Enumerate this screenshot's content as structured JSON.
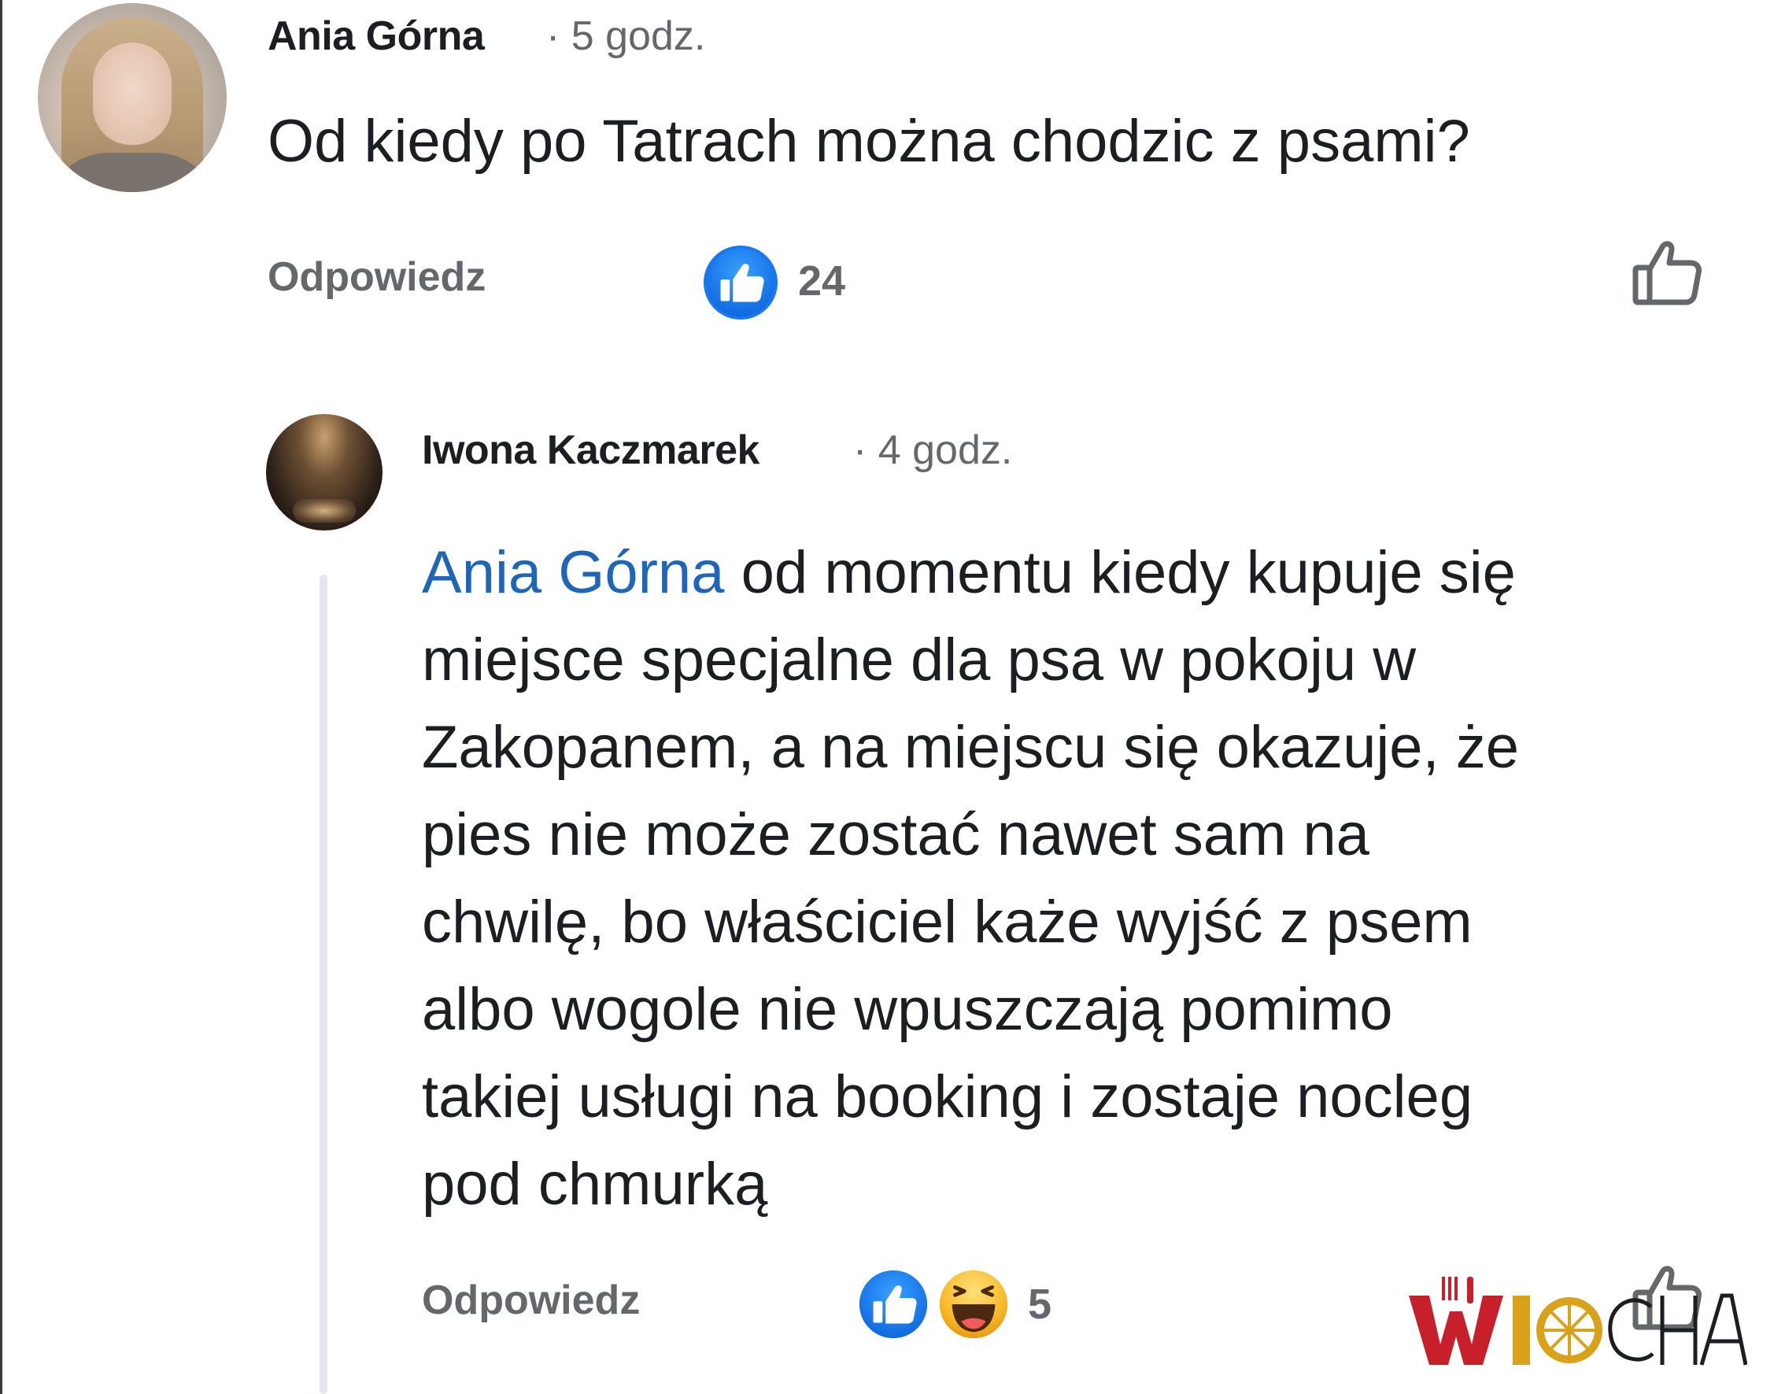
{
  "comments": [
    {
      "author": "Ania Górna",
      "time": "· 5 godz.",
      "text": "Od kiedy po Tatrach można chodzic z psami?",
      "reply_label": "Odpowiedz",
      "reaction_count": "24",
      "reactions": [
        "like"
      ]
    },
    {
      "author": "Iwona Kaczmarek",
      "time": "· 4 godz.",
      "mention": "Ania Górna",
      "text_lines": [
        " od momentu kiedy kupuje się",
        "miejsce specjalne dla psa w pokoju w",
        "Zakopanem, a na miejscu się okazuje, że",
        "pies nie może zostać nawet sam na",
        "chwilę, bo właściciel każe wyjść z psem",
        "albo wogole nie wpuszczają pomimo",
        "takiej usługi na booking i zostaje nocleg",
        "pod chmurką"
      ],
      "reply_label": "Odpowiedz",
      "reaction_count": "5",
      "reactions": [
        "like",
        "haha"
      ]
    }
  ],
  "watermark": {
    "logo": "WIOCHA"
  },
  "colors": {
    "mention": "#1f66b8",
    "secondary_text": "#65676b",
    "like_blue": "#1877f2",
    "watermark_red": "#c8202a",
    "watermark_gold": "#d9a21a"
  },
  "icons": {
    "like_reaction": "thumbs-up-icon",
    "haha_reaction": "laughing-face-icon",
    "like_action": "thumbs-up-outline-icon"
  }
}
